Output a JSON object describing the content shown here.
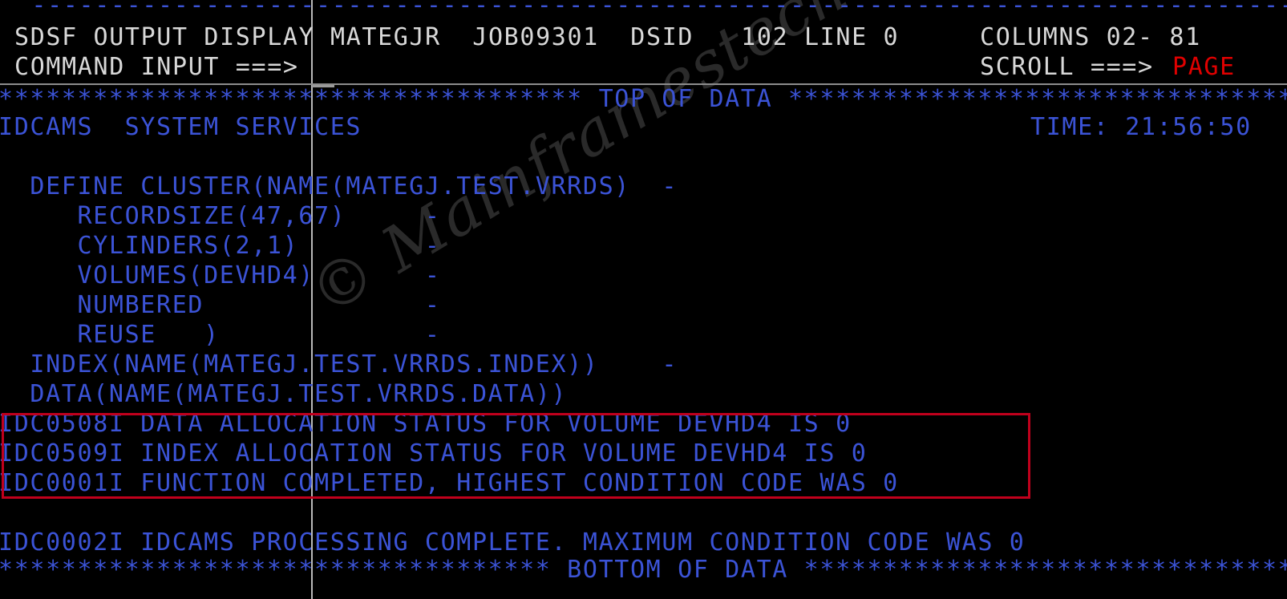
{
  "terminal": {
    "screen_name": "SDSF OUTPUT DISPLAY",
    "cols": 81,
    "top_rule": "  ----------------------------------------------------------------------------------",
    "colors": {
      "body_text": "#3b53d6",
      "header_text": "#d8d8d8",
      "accent_red": "#e00000",
      "annotation_box": "#c0001c",
      "background": "#000000",
      "rule": "#8d8d8d"
    }
  },
  "header": {
    "title": "SDSF OUTPUT DISPLAY",
    "jobname": "MATEGJR",
    "jobid": "JOB09301",
    "dsid_label": "DSID",
    "dsid_value": "102",
    "line_label": "LINE",
    "line_value": "0",
    "columns_label": "COLUMNS",
    "columns_value": "02- 81",
    "line1": "SDSF OUTPUT DISPLAY MATEGJR  JOB09301  DSID   102 LINE 0",
    "line1_right": "COLUMNS 02- 81",
    "command_label": "COMMAND INPUT ===>",
    "command_value": "",
    "scroll_label": "SCROLL ===>",
    "scroll_value": "PAGE"
  },
  "body": {
    "top_of_data": "************************************* TOP OF DATA **************************************",
    "bottom_of_data": "*********************************** BOTTOM OF DATA *************************************",
    "lines": [
      {
        "id": "idcams-banner",
        "text": "IDCAMS  SYSTEM SERVICES",
        "right_text": "TIME: 21:56:50"
      },
      {
        "id": "blank-1",
        "text": ""
      },
      {
        "id": "define-cluster",
        "text": "  DEFINE CLUSTER(NAME(MATEGJ.TEST.VRRDS)  -"
      },
      {
        "id": "recordsize",
        "text": "     RECORDSIZE(47,67)     -"
      },
      {
        "id": "cylinders",
        "text": "     CYLINDERS(2,1)        -"
      },
      {
        "id": "volumes",
        "text": "     VOLUMES(DEVHD4)       -"
      },
      {
        "id": "numbered",
        "text": "     NUMBERED              -"
      },
      {
        "id": "reuse",
        "text": "     REUSE   )             -"
      },
      {
        "id": "index-clause",
        "text": "  INDEX(NAME(MATEGJ.TEST.VRRDS.INDEX))    -"
      },
      {
        "id": "data-clause",
        "text": "  DATA(NAME(MATEGJ.TEST.VRRDS.DATA))"
      },
      {
        "id": "idc0508i",
        "text": "IDC0508I DATA ALLOCATION STATUS FOR VOLUME DEVHD4 IS 0"
      },
      {
        "id": "idc0509i",
        "text": "IDC0509I INDEX ALLOCATION STATUS FOR VOLUME DEVHD4 IS 0"
      },
      {
        "id": "idc0001i",
        "text": "IDC0001I FUNCTION COMPLETED, HIGHEST CONDITION CODE WAS 0"
      },
      {
        "id": "blank-2",
        "text": ""
      },
      {
        "id": "idc0002i",
        "text": "IDC0002I IDCAMS PROCESSING COMPLETE. MAXIMUM CONDITION CODE WAS 0"
      }
    ]
  },
  "annotation": {
    "label": "highlighted-messages",
    "color": "#c0001c"
  },
  "watermark": {
    "text": "© Mainframestechhelp"
  }
}
